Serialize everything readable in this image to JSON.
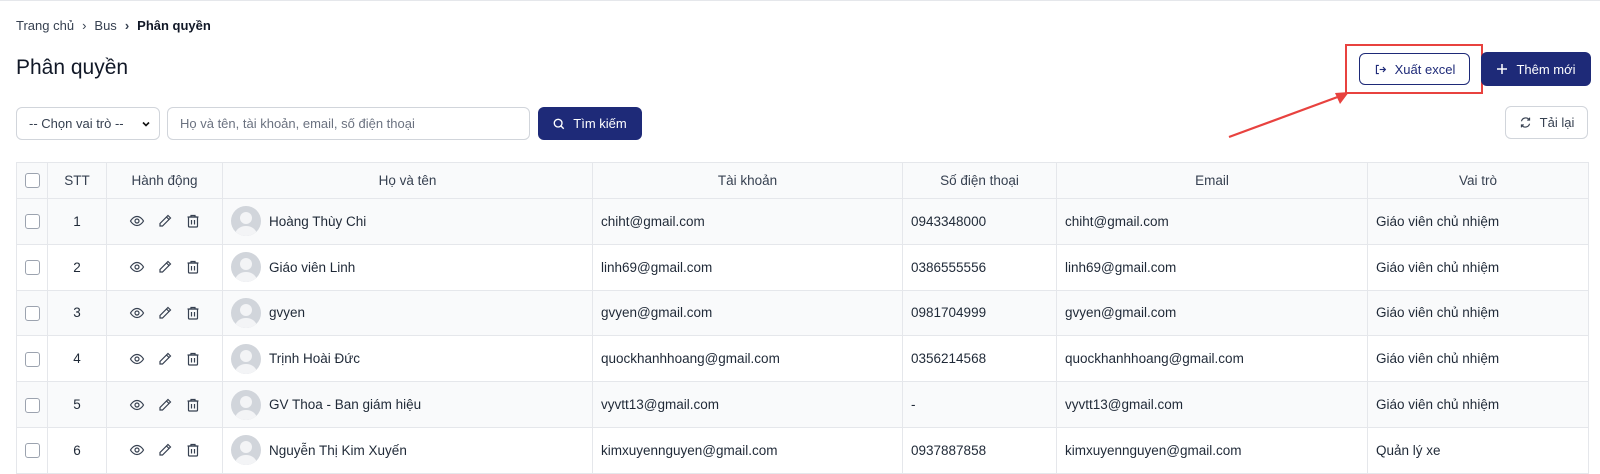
{
  "breadcrumb": {
    "home": "Trang chủ",
    "bus": "Bus",
    "current": "Phân quyền"
  },
  "page": {
    "title": "Phân quyền"
  },
  "toolbar": {
    "export_label": "Xuất excel",
    "add_label": "Thêm mới",
    "reload_label": "Tải lại",
    "search_label": "Tìm kiếm"
  },
  "filters": {
    "role_select": "-- Chọn vai trò --",
    "search_placeholder": "Họ và tên, tài khoản, email, số điện thoại"
  },
  "table": {
    "headers": [
      "STT",
      "Hành động",
      "Họ và tên",
      "Tài khoản",
      "Số điện thoại",
      "Email",
      "Vai trò"
    ],
    "rows": [
      {
        "stt": "1",
        "name": "Hoàng Thùy Chi",
        "username": "chiht@gmail.com",
        "phone": "0943348000",
        "email": "chiht@gmail.com",
        "role": "Giáo viên chủ nhiệm"
      },
      {
        "stt": "2",
        "name": "Giáo viên Linh",
        "username": "linh69@gmail.com",
        "phone": "0386555556",
        "email": "linh69@gmail.com",
        "role": "Giáo viên chủ nhiệm"
      },
      {
        "stt": "3",
        "name": "gvyen",
        "username": "gvyen@gmail.com",
        "phone": "0981704999",
        "email": "gvyen@gmail.com",
        "role": "Giáo viên chủ nhiệm"
      },
      {
        "stt": "4",
        "name": "Trịnh Hoài Đức",
        "username": "quockhanhhoang@gmail.com",
        "phone": "0356214568",
        "email": "quockhanhhoang@gmail.com",
        "role": "Giáo viên chủ nhiệm"
      },
      {
        "stt": "5",
        "name": "GV Thoa - Ban giám hiệu",
        "username": "vyvtt13@gmail.com",
        "phone": "-",
        "email": "vyvtt13@gmail.com",
        "role": "Giáo viên chủ nhiệm"
      },
      {
        "stt": "6",
        "name": "Nguyễn Thị Kim Xuyến",
        "username": "kimxuyennguyen@gmail.com",
        "phone": "0937887858",
        "email": "kimxuyennguyen@gmail.com",
        "role": "Quản lý xe"
      }
    ]
  },
  "colors": {
    "primary": "#1e2a78",
    "annotation": "#e8423f",
    "border": "#e5e7eb"
  },
  "icons": [
    "chevron-right-icon",
    "export-icon",
    "plus-icon",
    "reload-icon",
    "search-icon",
    "chevron-down-icon",
    "eye-icon",
    "pencil-icon",
    "trash-icon",
    "avatar-placeholder-icon"
  ]
}
